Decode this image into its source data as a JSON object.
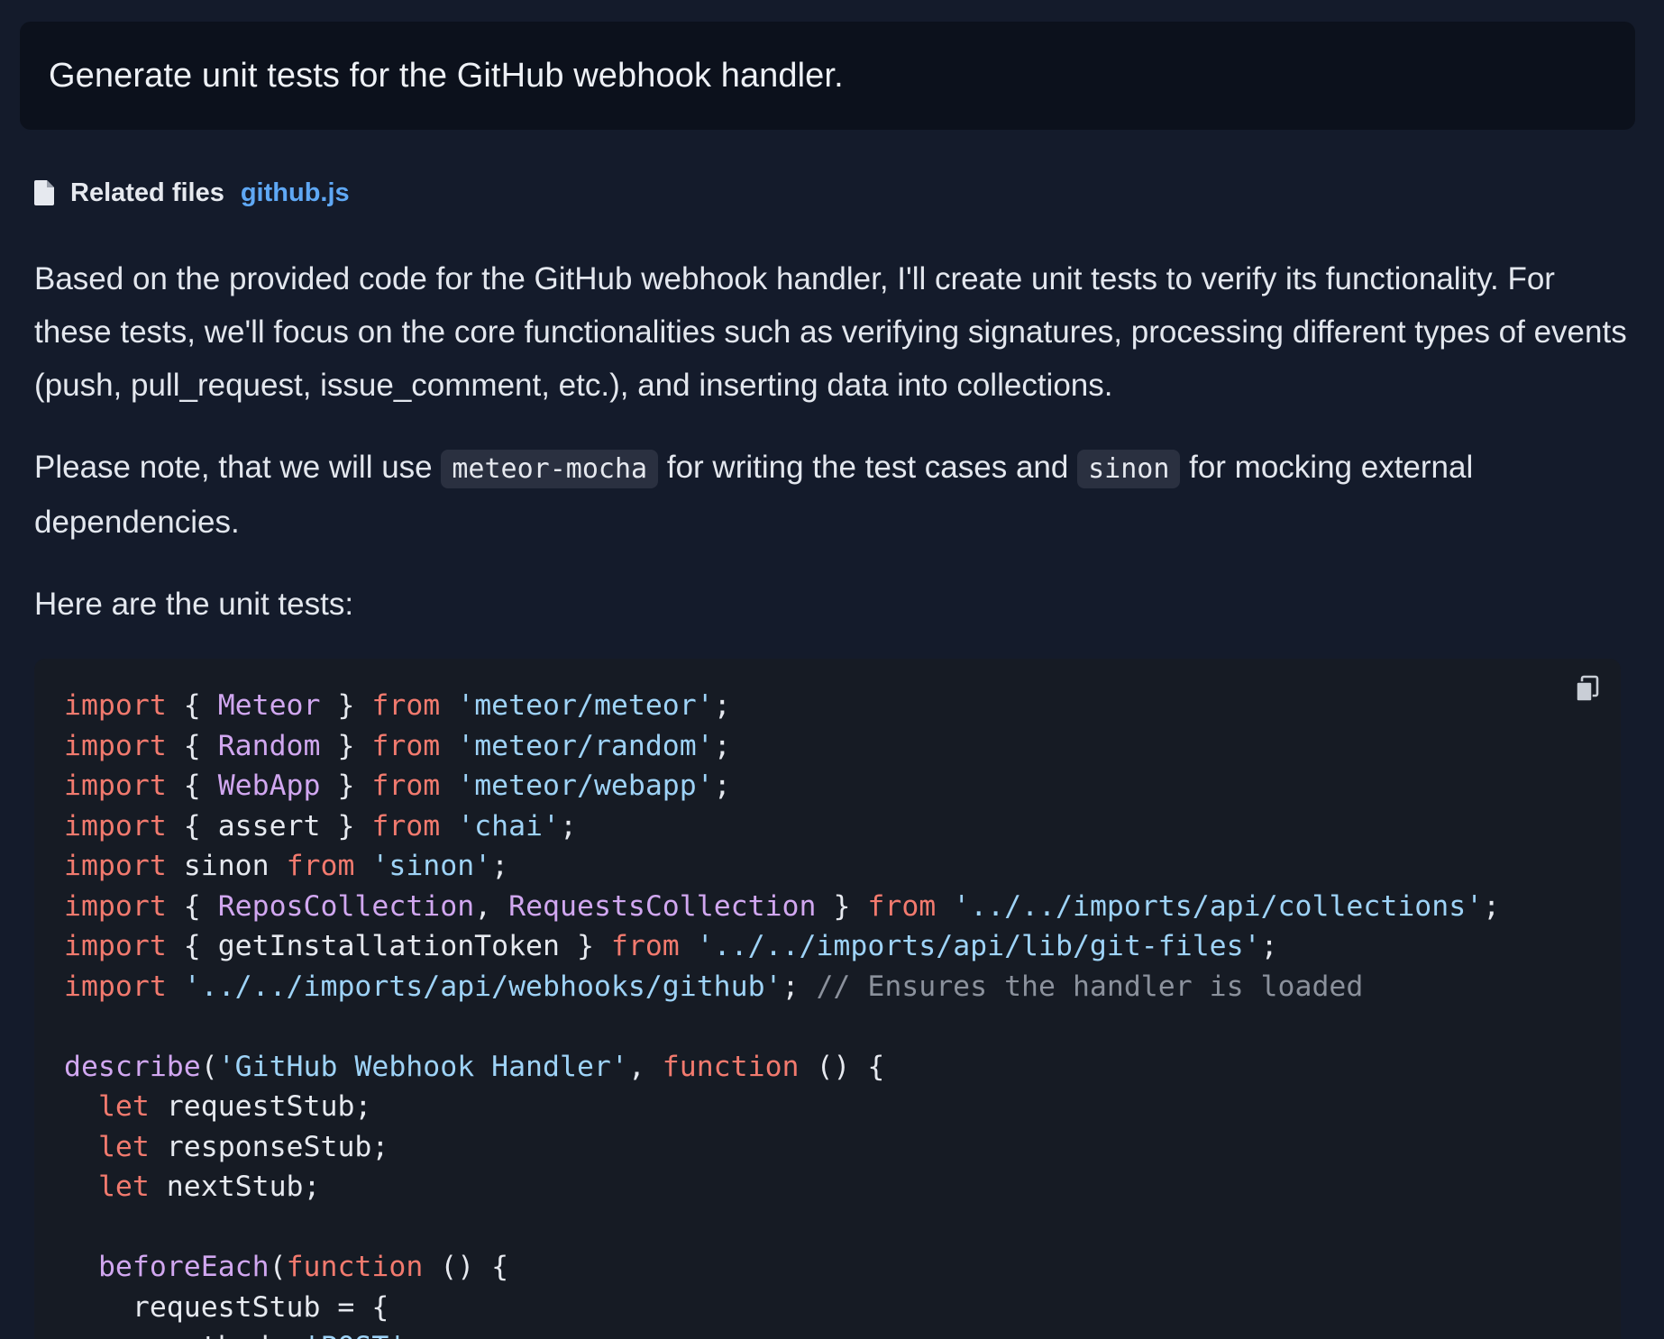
{
  "prompt": {
    "text": "Generate unit tests for the GitHub webhook handler."
  },
  "related_files": {
    "label": "Related files",
    "files": [
      "github.js"
    ],
    "icon": "file-icon"
  },
  "answer": {
    "para1": "Based on the provided code for the GitHub webhook handler, I'll create unit tests to verify its functionality. For these tests, we'll focus on the core functionalities such as verifying signatures, processing different types of events (push, pull_request, issue_comment, etc.), and inserting data into collections.",
    "para2_a": "Please note, that we will use ",
    "para2_code1": "meteor-mocha",
    "para2_b": " for writing the test cases and ",
    "para2_code2": "sinon",
    "para2_c": " for mocking external dependencies.",
    "para3": "Here are the unit tests:"
  },
  "code_block": {
    "copy_icon": "copy-icon",
    "lines": [
      [
        {
          "t": "import",
          "c": "kw"
        },
        {
          "t": " { ",
          "c": "plain"
        },
        {
          "t": "Meteor",
          "c": "cls"
        },
        {
          "t": " } ",
          "c": "plain"
        },
        {
          "t": "from",
          "c": "kw"
        },
        {
          "t": " ",
          "c": "plain"
        },
        {
          "t": "'meteor/meteor'",
          "c": "str"
        },
        {
          "t": ";",
          "c": "plain"
        }
      ],
      [
        {
          "t": "import",
          "c": "kw"
        },
        {
          "t": " { ",
          "c": "plain"
        },
        {
          "t": "Random",
          "c": "cls"
        },
        {
          "t": " } ",
          "c": "plain"
        },
        {
          "t": "from",
          "c": "kw"
        },
        {
          "t": " ",
          "c": "plain"
        },
        {
          "t": "'meteor/random'",
          "c": "str"
        },
        {
          "t": ";",
          "c": "plain"
        }
      ],
      [
        {
          "t": "import",
          "c": "kw"
        },
        {
          "t": " { ",
          "c": "plain"
        },
        {
          "t": "WebApp",
          "c": "cls"
        },
        {
          "t": " } ",
          "c": "plain"
        },
        {
          "t": "from",
          "c": "kw"
        },
        {
          "t": " ",
          "c": "plain"
        },
        {
          "t": "'meteor/webapp'",
          "c": "str"
        },
        {
          "t": ";",
          "c": "plain"
        }
      ],
      [
        {
          "t": "import",
          "c": "kw"
        },
        {
          "t": " { assert } ",
          "c": "plain"
        },
        {
          "t": "from",
          "c": "kw"
        },
        {
          "t": " ",
          "c": "plain"
        },
        {
          "t": "'chai'",
          "c": "str"
        },
        {
          "t": ";",
          "c": "plain"
        }
      ],
      [
        {
          "t": "import",
          "c": "kw"
        },
        {
          "t": " sinon ",
          "c": "plain"
        },
        {
          "t": "from",
          "c": "kw"
        },
        {
          "t": " ",
          "c": "plain"
        },
        {
          "t": "'sinon'",
          "c": "str"
        },
        {
          "t": ";",
          "c": "plain"
        }
      ],
      [
        {
          "t": "import",
          "c": "kw"
        },
        {
          "t": " { ",
          "c": "plain"
        },
        {
          "t": "ReposCollection",
          "c": "cls"
        },
        {
          "t": ", ",
          "c": "plain"
        },
        {
          "t": "RequestsCollection",
          "c": "cls"
        },
        {
          "t": " } ",
          "c": "plain"
        },
        {
          "t": "from",
          "c": "kw"
        },
        {
          "t": " ",
          "c": "plain"
        },
        {
          "t": "'../../imports/api/collections'",
          "c": "str"
        },
        {
          "t": ";",
          "c": "plain"
        }
      ],
      [
        {
          "t": "import",
          "c": "kw"
        },
        {
          "t": " { getInstallationToken } ",
          "c": "plain"
        },
        {
          "t": "from",
          "c": "kw"
        },
        {
          "t": " ",
          "c": "plain"
        },
        {
          "t": "'../../imports/api/lib/git-files'",
          "c": "str"
        },
        {
          "t": ";",
          "c": "plain"
        }
      ],
      [
        {
          "t": "import",
          "c": "kw"
        },
        {
          "t": " ",
          "c": "plain"
        },
        {
          "t": "'../../imports/api/webhooks/github'",
          "c": "str"
        },
        {
          "t": "; ",
          "c": "plain"
        },
        {
          "t": "// Ensures the handler is loaded",
          "c": "cmt"
        }
      ],
      [],
      [
        {
          "t": "describe",
          "c": "fn"
        },
        {
          "t": "(",
          "c": "plain"
        },
        {
          "t": "'GitHub Webhook Handler'",
          "c": "str"
        },
        {
          "t": ", ",
          "c": "plain"
        },
        {
          "t": "function",
          "c": "kw"
        },
        {
          "t": " () {",
          "c": "plain"
        }
      ],
      [
        {
          "t": "  ",
          "c": "plain"
        },
        {
          "t": "let",
          "c": "kw"
        },
        {
          "t": " requestStub;",
          "c": "plain"
        }
      ],
      [
        {
          "t": "  ",
          "c": "plain"
        },
        {
          "t": "let",
          "c": "kw"
        },
        {
          "t": " responseStub;",
          "c": "plain"
        }
      ],
      [
        {
          "t": "  ",
          "c": "plain"
        },
        {
          "t": "let",
          "c": "kw"
        },
        {
          "t": " nextStub;",
          "c": "plain"
        }
      ],
      [],
      [
        {
          "t": "  ",
          "c": "plain"
        },
        {
          "t": "beforeEach",
          "c": "fn"
        },
        {
          "t": "(",
          "c": "plain"
        },
        {
          "t": "function",
          "c": "kw"
        },
        {
          "t": " () {",
          "c": "plain"
        }
      ],
      [
        {
          "t": "    requestStub = {",
          "c": "plain"
        }
      ],
      [
        {
          "t": "      method: ",
          "c": "plain"
        },
        {
          "t": "'POST'",
          "c": "str"
        },
        {
          "t": ",",
          "c": "plain"
        }
      ]
    ]
  },
  "colors": {
    "background": "#141b2b",
    "prompt_bg": "#0c111c",
    "code_bg": "#161b24",
    "link": "#5fa8f5",
    "keyword": "#f27a6e",
    "class_name": "#d1a7f0",
    "string": "#9ed3f7",
    "comment": "#8b919c"
  }
}
